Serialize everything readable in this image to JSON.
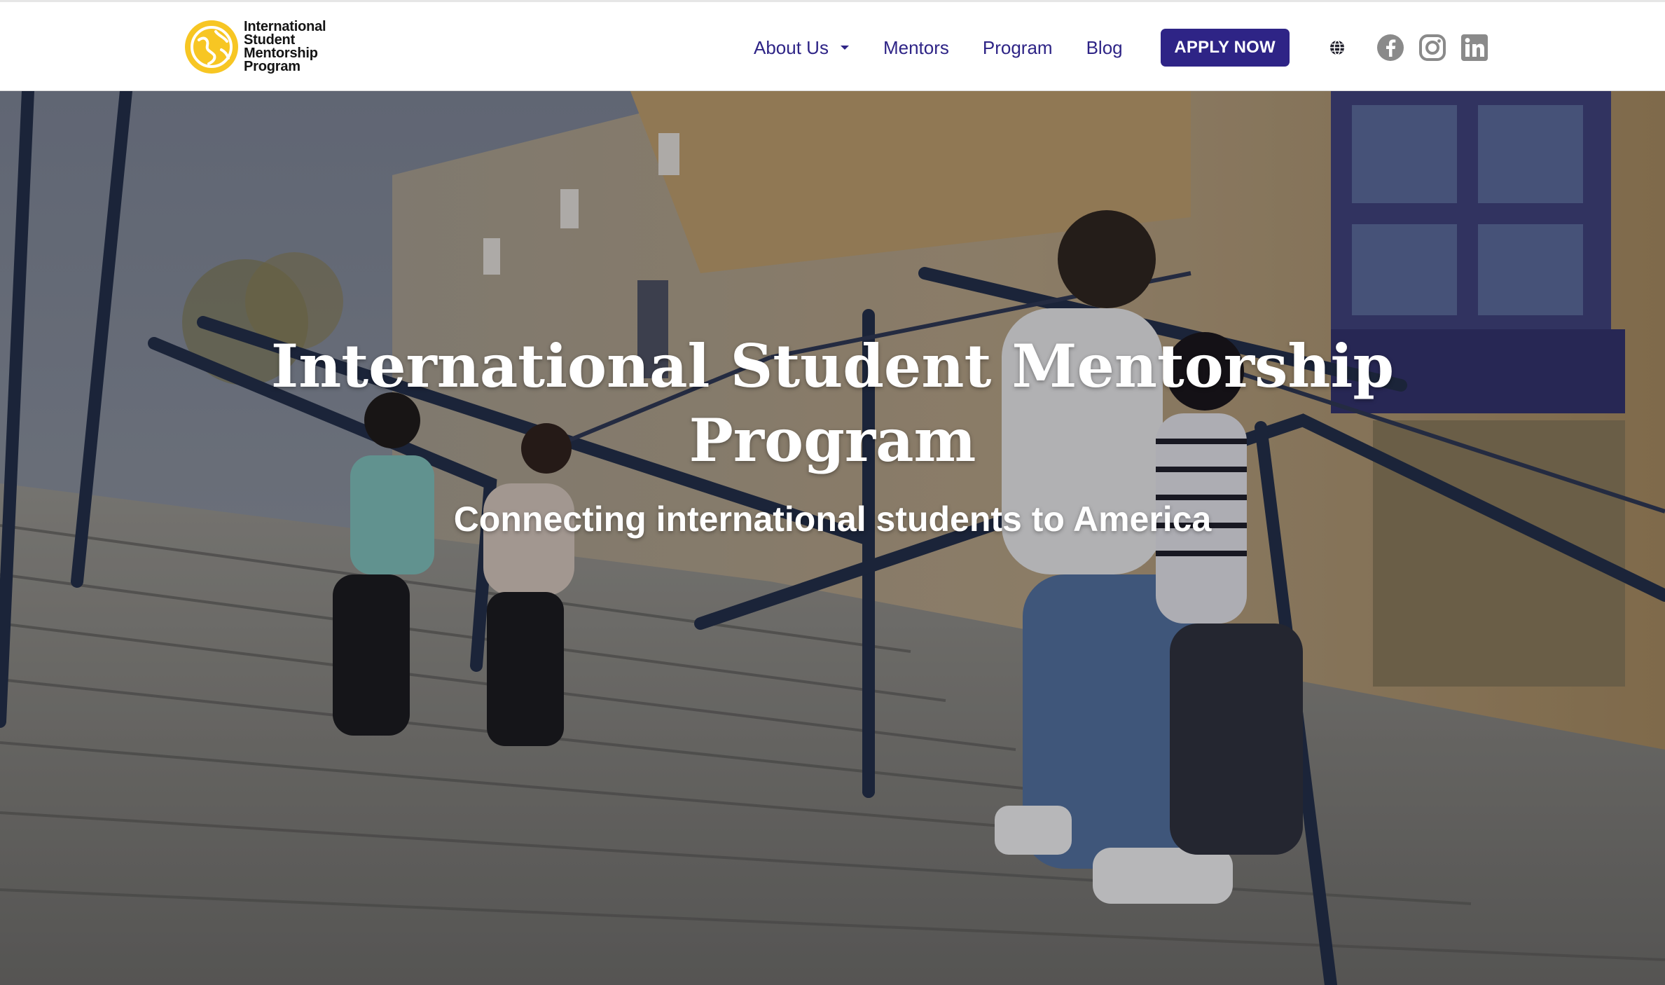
{
  "header": {
    "logo": {
      "line1": "International",
      "line2": "Student",
      "line3": "Mentorship",
      "line4": "Program"
    },
    "nav": {
      "about": "About Us",
      "mentors": "Mentors",
      "program": "Program",
      "blog": "Blog"
    },
    "apply_label": "APPLY NOW",
    "icons": {
      "language": "globe-icon",
      "social": [
        "facebook-icon",
        "instagram-icon",
        "linkedin-icon"
      ]
    }
  },
  "hero": {
    "title_line1": "International Student Mentorship",
    "title_line2": "Program",
    "subtitle": "Connecting international students to America"
  },
  "colors": {
    "brand_purple": "#2e2486",
    "logo_yellow": "#f7c623",
    "social_gray": "#8a8a8a"
  }
}
